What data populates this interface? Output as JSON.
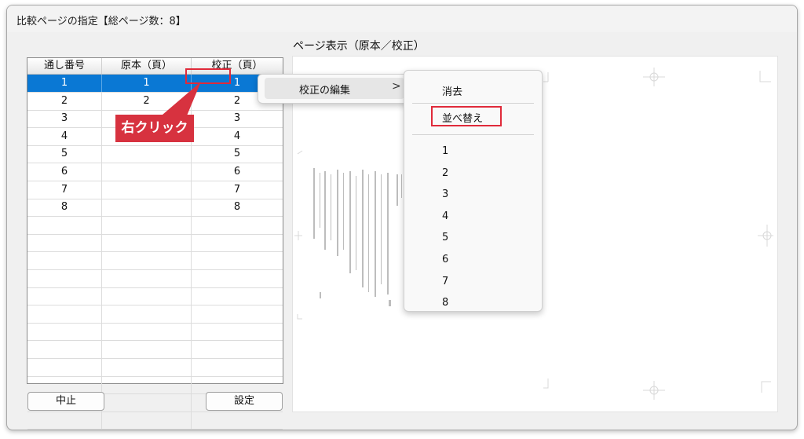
{
  "dialog": {
    "title": "比較ページの指定【総ページ数：8】"
  },
  "table": {
    "headers": [
      "通し番号",
      "原本（頁）",
      "校正（頁）"
    ],
    "rows": [
      [
        "1",
        "1",
        "1"
      ],
      [
        "2",
        "2",
        "2"
      ],
      [
        "3",
        "",
        "3"
      ],
      [
        "4",
        "",
        "4"
      ],
      [
        "5",
        "",
        "5"
      ],
      [
        "6",
        "",
        "6"
      ],
      [
        "7",
        "",
        "7"
      ],
      [
        "8",
        "",
        "8"
      ]
    ],
    "selected_row": 0
  },
  "callout": {
    "text": "右クリック"
  },
  "buttons": {
    "cancel": "中止",
    "set": "設定"
  },
  "preview": {
    "label": "ページ表示（原本／校正）"
  },
  "context_menu": {
    "item": "校正の編集",
    "arrow": ">"
  },
  "submenu": {
    "delete": "消去",
    "sort": "並べ替え",
    "pages": [
      "1",
      "2",
      "3",
      "4",
      "5",
      "6",
      "7",
      "8"
    ]
  },
  "colors": {
    "selection": "#0a78d4",
    "highlight": "#e02a3a",
    "callout": "#d7323f"
  }
}
